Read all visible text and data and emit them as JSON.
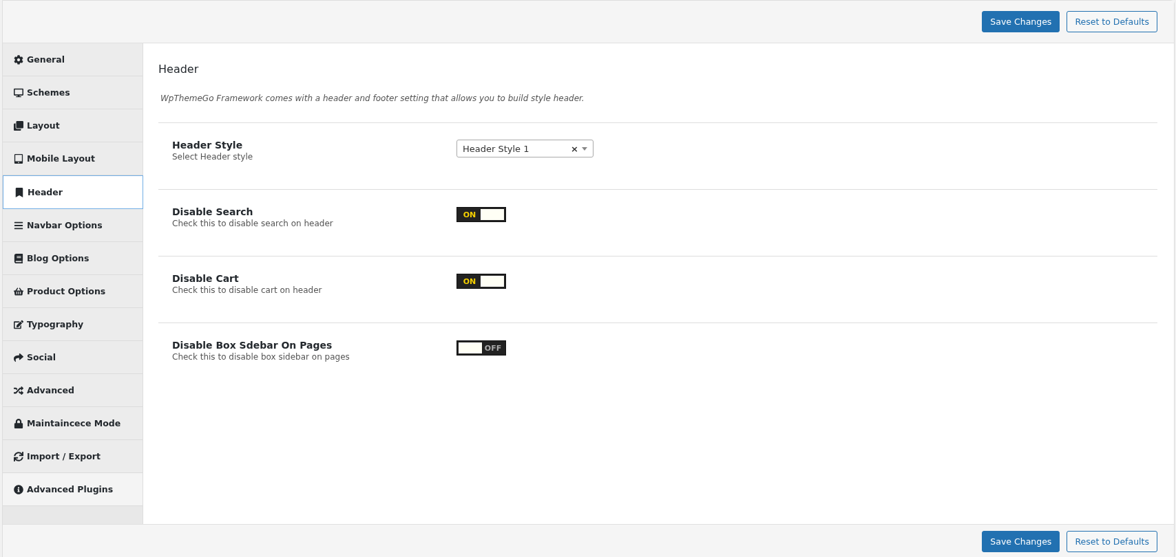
{
  "top_bar": {
    "buttons": [
      {
        "label": "Save Changes",
        "kind": "primary"
      },
      {
        "label": "Reset to Defaults",
        "kind": "secondary"
      }
    ]
  },
  "sidebar": {
    "items": [
      {
        "label": "General",
        "selected": false
      },
      {
        "label": "Schemes",
        "selected": false
      },
      {
        "label": "Layout",
        "selected": false
      },
      {
        "label": "Mobile Layout",
        "selected": false
      },
      {
        "label": "Header",
        "selected": true
      },
      {
        "label": "Navbar Options",
        "selected": false
      },
      {
        "label": "Blog Options",
        "selected": false
      },
      {
        "label": "Product Options",
        "selected": false
      },
      {
        "label": "Typography",
        "selected": false
      },
      {
        "label": "Social",
        "selected": false
      },
      {
        "label": "Advanced",
        "selected": false
      },
      {
        "label": "Maintaincece Mode",
        "selected": false
      },
      {
        "label": "Import / Export",
        "selected": false
      },
      {
        "label": "Advanced Plugins",
        "selected": false
      }
    ]
  },
  "section": {
    "title": "Header",
    "description": "WpThemeGo Framework comes with a header and footer setting that allows you to build style header.",
    "settings": [
      {
        "kind": "select",
        "label": "Header Style",
        "hint": "Select Header style",
        "value": "Header Style 1",
        "clear": "×"
      },
      {
        "kind": "toggle",
        "label": "Disable Search",
        "hint": "Check this to disable search on header",
        "on": true,
        "state_text": "ON"
      },
      {
        "kind": "toggle",
        "label": "Disable Cart",
        "hint": "Check this to disable cart on header",
        "on": true,
        "state_text": "ON"
      },
      {
        "kind": "toggle",
        "label": "Disable Box Sdebar On Pages",
        "hint": "Check this to disable box sidebar on pages",
        "on": false,
        "state_text": "OFF"
      }
    ]
  },
  "bottom_bar": {
    "buttons": [
      {
        "label": "Save Changes",
        "kind": "primary"
      },
      {
        "label": "Reset to Defaults",
        "kind": "secondary"
      }
    ]
  }
}
